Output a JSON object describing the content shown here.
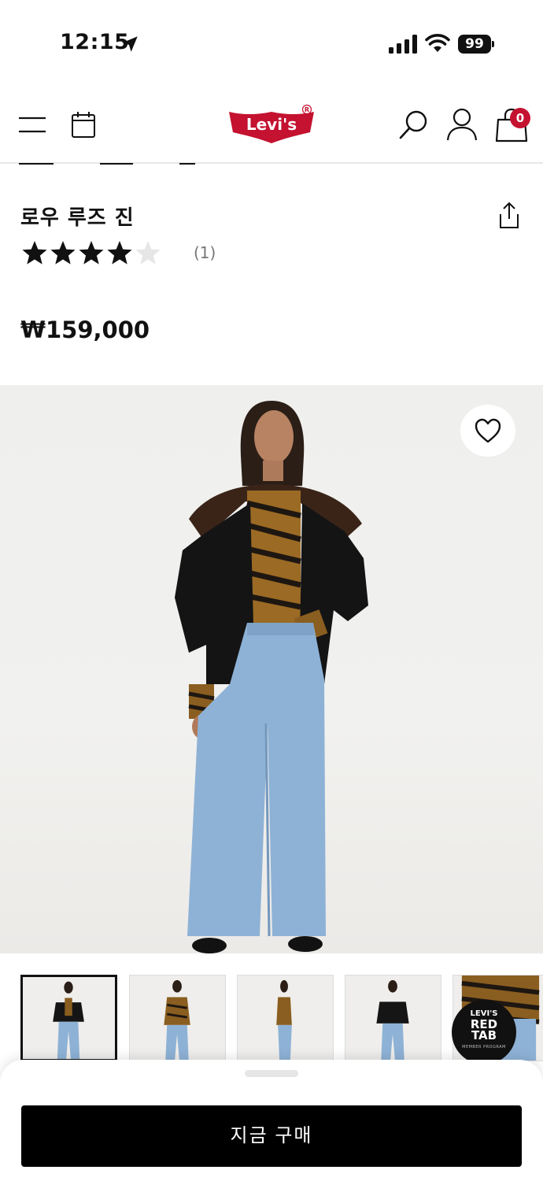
{
  "status_bar": {
    "time": "12:15",
    "battery": "99"
  },
  "header": {
    "logo_text": "Levi's",
    "cart_count": "0"
  },
  "product": {
    "title": "로우 루즈 진",
    "rating": 4,
    "rating_max": 5,
    "review_count": "(1)",
    "price": "₩159,000"
  },
  "gallery": {
    "thumbnail_count": 5,
    "selected_index": 0
  },
  "promo": {
    "brand": "LEVI'S",
    "line1": "RED",
    "line2": "TAB",
    "sub": "MEMBER PROGRAM"
  },
  "actions": {
    "buy_now": "지금 구매"
  },
  "colors": {
    "brand_red": "#c41230",
    "button_black": "#000000",
    "star_filled": "#111111",
    "star_empty": "#e6e6e6"
  }
}
